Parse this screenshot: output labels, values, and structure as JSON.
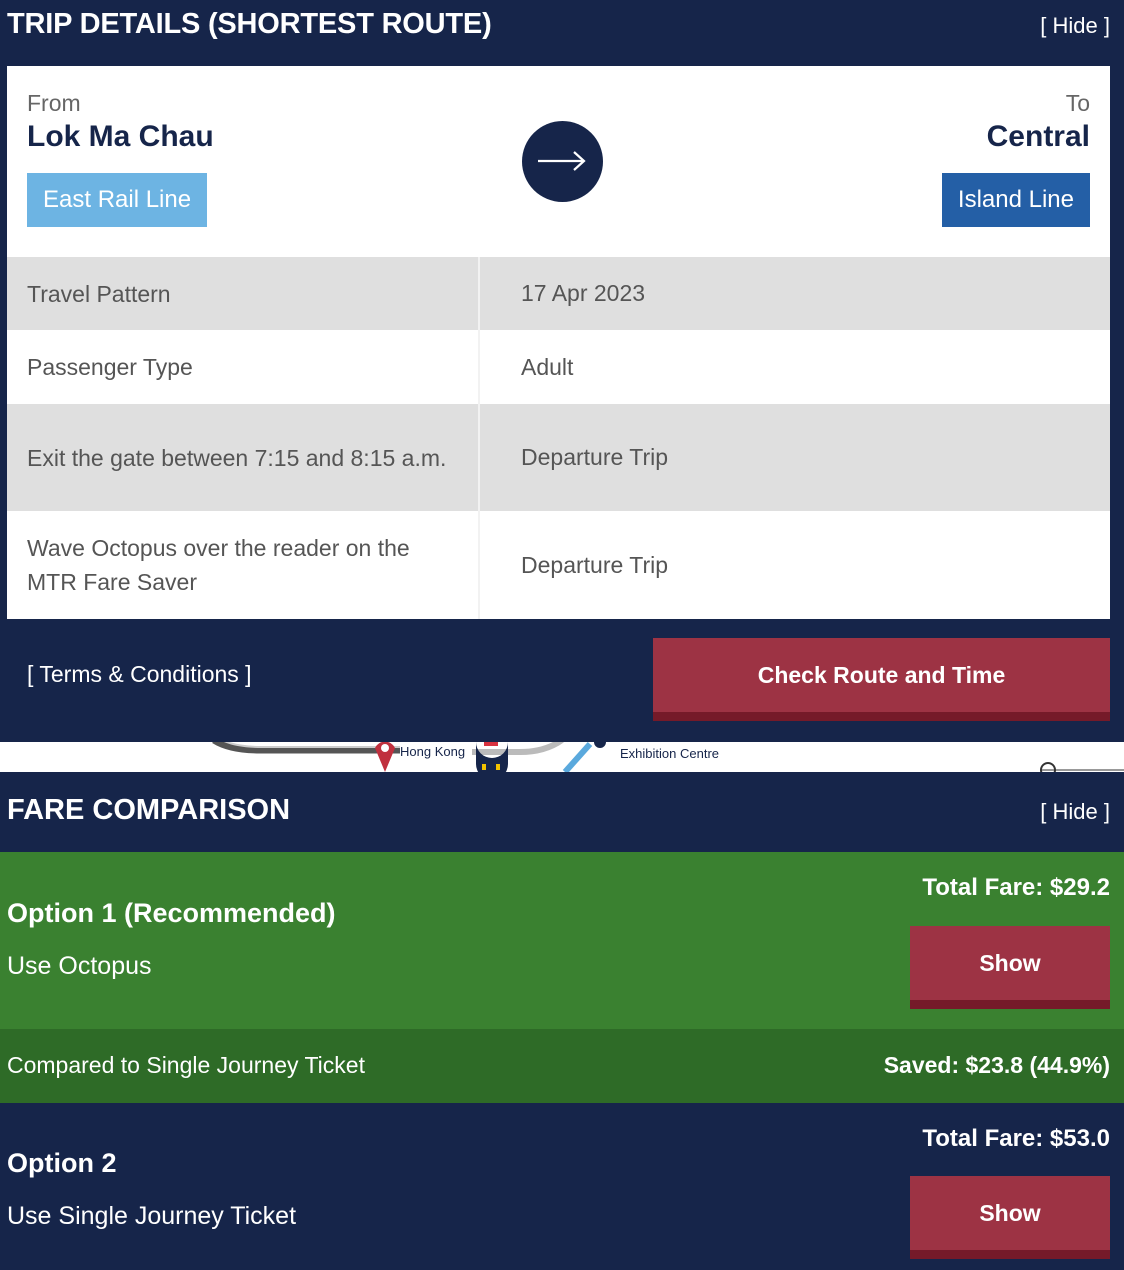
{
  "trip": {
    "title": "TRIP DETAILS (SHORTEST ROUTE)",
    "hide_label": "[ Hide ]",
    "from_label": "From",
    "from_station": "Lok Ma Chau",
    "from_line": "East Rail Line",
    "to_label": "To",
    "to_station": "Central",
    "to_line": "Island Line",
    "rows": [
      {
        "label": "Travel Pattern",
        "value": "17 Apr 2023"
      },
      {
        "label": "Passenger Type",
        "value": "Adult"
      },
      {
        "label": "Exit the gate between 7:15 and 8:15 a.m.",
        "value": "Departure Trip"
      },
      {
        "label": "Wave Octopus over the reader on the MTR Fare Saver",
        "value": "Departure Trip"
      }
    ],
    "terms_label": "[ Terms & Conditions ]",
    "check_button": "Check Route and Time"
  },
  "map": {
    "label_1": "Hong Kong",
    "label_2": "Exhibition Centre"
  },
  "fare": {
    "title": "FARE COMPARISON",
    "hide_label": "[ Hide ]",
    "option1": {
      "title": "Option 1 (Recommended)",
      "desc": "Use Octopus",
      "total": "Total Fare: $29.2",
      "show": "Show"
    },
    "saved": {
      "label": "Compared to Single Journey Ticket",
      "value": "Saved: $23.8 (44.9%)"
    },
    "option2": {
      "title": "Option 2",
      "desc": "Use Single Journey Ticket",
      "total": "Total Fare: $53.0",
      "show": "Show"
    }
  },
  "colors": {
    "navy": "#16254a",
    "east_rail": "#6db4e3",
    "island_line": "#245fa6",
    "button_red": "#9d3344",
    "recommended_green": "#3a8130",
    "saved_green": "#2e6b27"
  }
}
